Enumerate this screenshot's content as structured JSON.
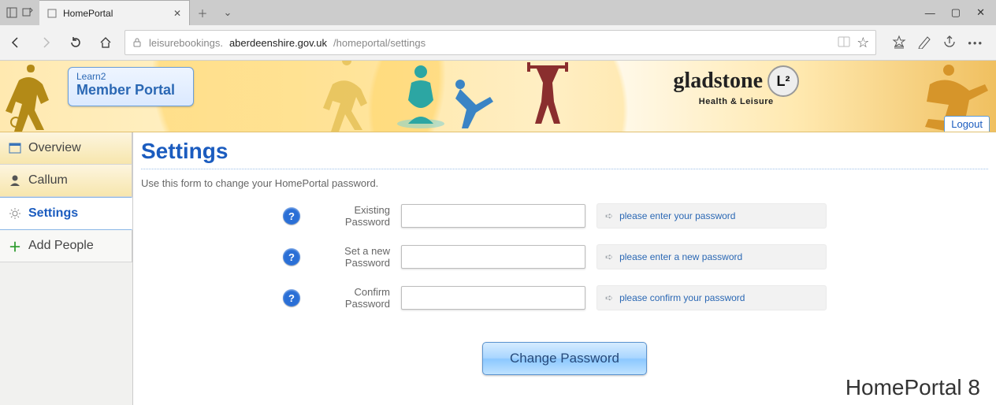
{
  "browser": {
    "tab_title": "HomePortal",
    "url_prefix": "leisurebookings.",
    "url_host": "aberdeenshire.gov.uk",
    "url_path": "/homeportal/settings"
  },
  "banner": {
    "badge_line1": "Learn2",
    "badge_line2": "Member Portal",
    "brand_name": "gladstone",
    "brand_mark": "L²",
    "brand_sub": "Health & Leisure",
    "logout": "Logout"
  },
  "sidebar": {
    "overview": "Overview",
    "user": "Callum",
    "settings": "Settings",
    "add_people": "Add People"
  },
  "page": {
    "title": "Settings",
    "intro": "Use this form to change your HomePortal password.",
    "labels": {
      "existing1": "Existing",
      "existing2": "Password",
      "new1": "Set a new",
      "new2": "Password",
      "confirm1": "Confirm",
      "confirm2": "Password"
    },
    "hints": {
      "existing": "please enter your password",
      "new": "please enter a new password",
      "confirm": "please confirm your password"
    },
    "submit": "Change Password",
    "product": "HomePortal 8"
  }
}
